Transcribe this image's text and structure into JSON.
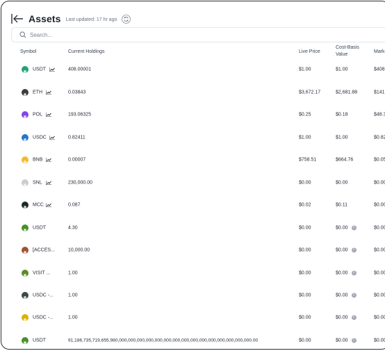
{
  "header": {
    "title": "Assets",
    "last_updated": "Last updated: 17 hr ago"
  },
  "search": {
    "placeholder": "Search..."
  },
  "columns": {
    "symbol": "Symbol",
    "holdings": "Current Holdings",
    "live_price": "Live Price",
    "cost_basis_1": "Cost-Basis",
    "cost_basis_2": "Value",
    "market": "Mark"
  },
  "rows": [
    {
      "symbol": "USDT",
      "icon": "tether-icon",
      "color": "#26a17b",
      "chart": true,
      "holdings": "408.00001",
      "live": "$1.00",
      "cost": "$1.00",
      "info": false,
      "market": "$408"
    },
    {
      "symbol": "ETH",
      "icon": "ethereum-icon",
      "color": "#3c3c3d",
      "chart": true,
      "holdings": "0.03843",
      "live": "$3,672.17",
      "cost": "$2,681.88",
      "info": false,
      "market": "$141."
    },
    {
      "symbol": "POL",
      "icon": "polygon-icon",
      "color": "#8247e5",
      "chart": true,
      "holdings": "193.06325",
      "live": "$0.25",
      "cost": "$0.18",
      "info": false,
      "market": "$48.3"
    },
    {
      "symbol": "USDC",
      "icon": "usdc-icon",
      "color": "#2775ca",
      "chart": true,
      "holdings": "0.82411",
      "live": "$1.00",
      "cost": "$1.00",
      "info": false,
      "market": "$0.82"
    },
    {
      "symbol": "BNB",
      "icon": "bnb-icon",
      "color": "#f3ba2f",
      "chart": true,
      "holdings": "0.00007",
      "live": "$758.51",
      "cost": "$664.76",
      "info": false,
      "market": "$0.05"
    },
    {
      "symbol": "SNL",
      "icon": "snl-icon",
      "color": "#c9ccd1",
      "chart": true,
      "holdings": "230,000.00",
      "live": "$0.00",
      "cost": "$0.00",
      "info": false,
      "market": "$0.00"
    },
    {
      "symbol": "MCC",
      "icon": "mcc-icon",
      "color": "#1e2a24",
      "chart": true,
      "holdings": "0.087",
      "live": "$0.02",
      "cost": "$0.11",
      "info": false,
      "market": "$0.00"
    },
    {
      "symbol": "USDT",
      "icon": "usdt-token-icon",
      "color": "#4a8f2c",
      "chart": false,
      "holdings": "4.30",
      "live": "$0.00",
      "cost": "$0.00",
      "info": true,
      "market": "$0.00"
    },
    {
      "symbol": "[ACCES...",
      "icon": "access-token-icon",
      "color": "#a0522d",
      "chart": false,
      "holdings": "10,000.00",
      "live": "$0.00",
      "cost": "$0.00",
      "info": true,
      "market": "$0.00"
    },
    {
      "symbol": "VISIT ...",
      "icon": "visit-token-icon",
      "color": "#5b8c2a",
      "chart": false,
      "holdings": "1.00",
      "live": "$0.00",
      "cost": "$0.00",
      "info": true,
      "market": "$0.00"
    },
    {
      "symbol": "USDC -...",
      "icon": "usdc-variant-icon",
      "color": "#3a4a44",
      "chart": false,
      "holdings": "1.00",
      "live": "$0.00",
      "cost": "$0.00",
      "info": true,
      "market": "$0.00"
    },
    {
      "symbol": "USDC -...",
      "icon": "usdc-variant-2-icon",
      "color": "#d9b300",
      "chart": false,
      "holdings": "1.00",
      "live": "$0.00",
      "cost": "$0.00",
      "info": true,
      "market": "$0.00"
    },
    {
      "symbol": "USDT",
      "icon": "usdt-token-2-icon",
      "color": "#4a8f2c",
      "chart": false,
      "holdings": "91,186,735,719,655,980,000,000,000,000,000,000,000,000,000,000,000,000,000,000,000.00",
      "live": "$0.00",
      "cost": "$0.00",
      "info": true,
      "market": "$0.00"
    }
  ]
}
